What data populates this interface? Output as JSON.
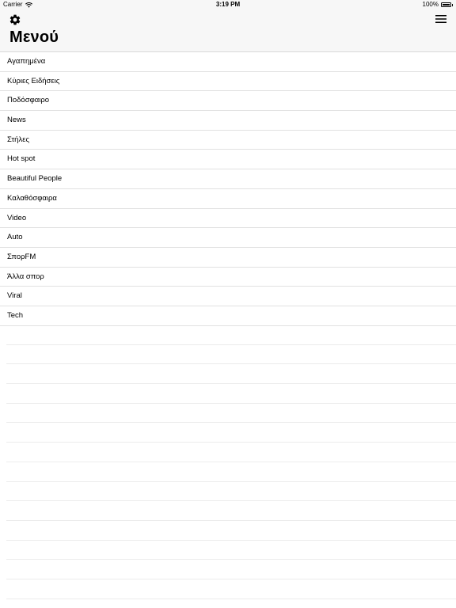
{
  "status_bar": {
    "carrier": "Carrier",
    "time": "3:19 PM",
    "battery": "100%",
    "battery_level": 1.0
  },
  "nav": {
    "title": "Μενού",
    "settings_icon": "gear-icon",
    "menu_icon": "hamburger-icon"
  },
  "menu": {
    "items": [
      {
        "label": "Αγαπημένα"
      },
      {
        "label": "Κύριες Ειδήσεις"
      },
      {
        "label": "Ποδόσφαιρο"
      },
      {
        "label": "News"
      },
      {
        "label": "Στήλες"
      },
      {
        "label": "Hot spot"
      },
      {
        "label": "Beautiful People"
      },
      {
        "label": "Καλαθόσφαιρα"
      },
      {
        "label": "Video"
      },
      {
        "label": "Auto"
      },
      {
        "label": "ΣπορFM"
      },
      {
        "label": "Άλλα σπορ"
      },
      {
        "label": "Viral"
      },
      {
        "label": "Tech"
      }
    ]
  },
  "colors": {
    "bar_background": "#f7f7f7",
    "separator": "#e1e1e1"
  }
}
